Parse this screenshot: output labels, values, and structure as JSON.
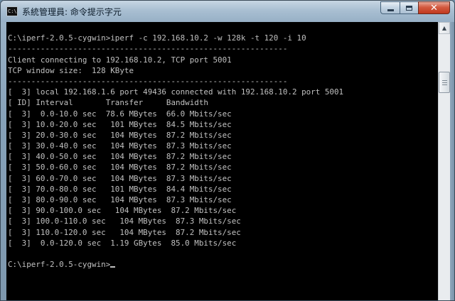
{
  "window": {
    "title": "系統管理員: 命令提示字元",
    "icon_label": "C:\\",
    "close_label": "✕"
  },
  "console": {
    "lines": [
      "",
      "C:\\iperf-2.0.5-cygwin>iperf -c 192.168.10.2 -w 128k -t 120 -i 10",
      "------------------------------------------------------------",
      "Client connecting to 192.168.10.2, TCP port 5001",
      "TCP window size:  128 KByte",
      "------------------------------------------------------------",
      "[  3] local 192.168.1.6 port 49436 connected with 192.168.10.2 port 5001",
      "[ ID] Interval       Transfer     Bandwidth",
      "[  3]  0.0-10.0 sec  78.6 MBytes  66.0 Mbits/sec",
      "[  3] 10.0-20.0 sec   101 MBytes  84.5 Mbits/sec",
      "[  3] 20.0-30.0 sec   104 MBytes  87.2 Mbits/sec",
      "[  3] 30.0-40.0 sec   104 MBytes  87.3 Mbits/sec",
      "[  3] 40.0-50.0 sec   104 MBytes  87.2 Mbits/sec",
      "[  3] 50.0-60.0 sec   104 MBytes  87.2 Mbits/sec",
      "[  3] 60.0-70.0 sec   104 MBytes  87.3 Mbits/sec",
      "[  3] 70.0-80.0 sec   101 MBytes  84.4 Mbits/sec",
      "[  3] 80.0-90.0 sec   104 MBytes  87.3 Mbits/sec",
      "[  3] 90.0-100.0 sec   104 MBytes  87.2 Mbits/sec",
      "[  3] 100.0-110.0 sec   104 MBytes  87.3 Mbits/sec",
      "[  3] 110.0-120.0 sec   104 MBytes  87.2 Mbits/sec",
      "[  3]  0.0-120.0 sec  1.19 GBytes  85.0 Mbits/sec",
      "",
      "C:\\iperf-2.0.5-cygwin>"
    ]
  },
  "icons": {
    "app": "console-app-icon",
    "minimize": "minimize-icon",
    "maximize": "maximize-icon",
    "close": "close-icon",
    "scroll_up": "scroll-up-arrow-icon"
  },
  "colors": {
    "console_bg": "#000000",
    "console_fg": "#c0c0c0",
    "close_button": "#c0391e"
  }
}
